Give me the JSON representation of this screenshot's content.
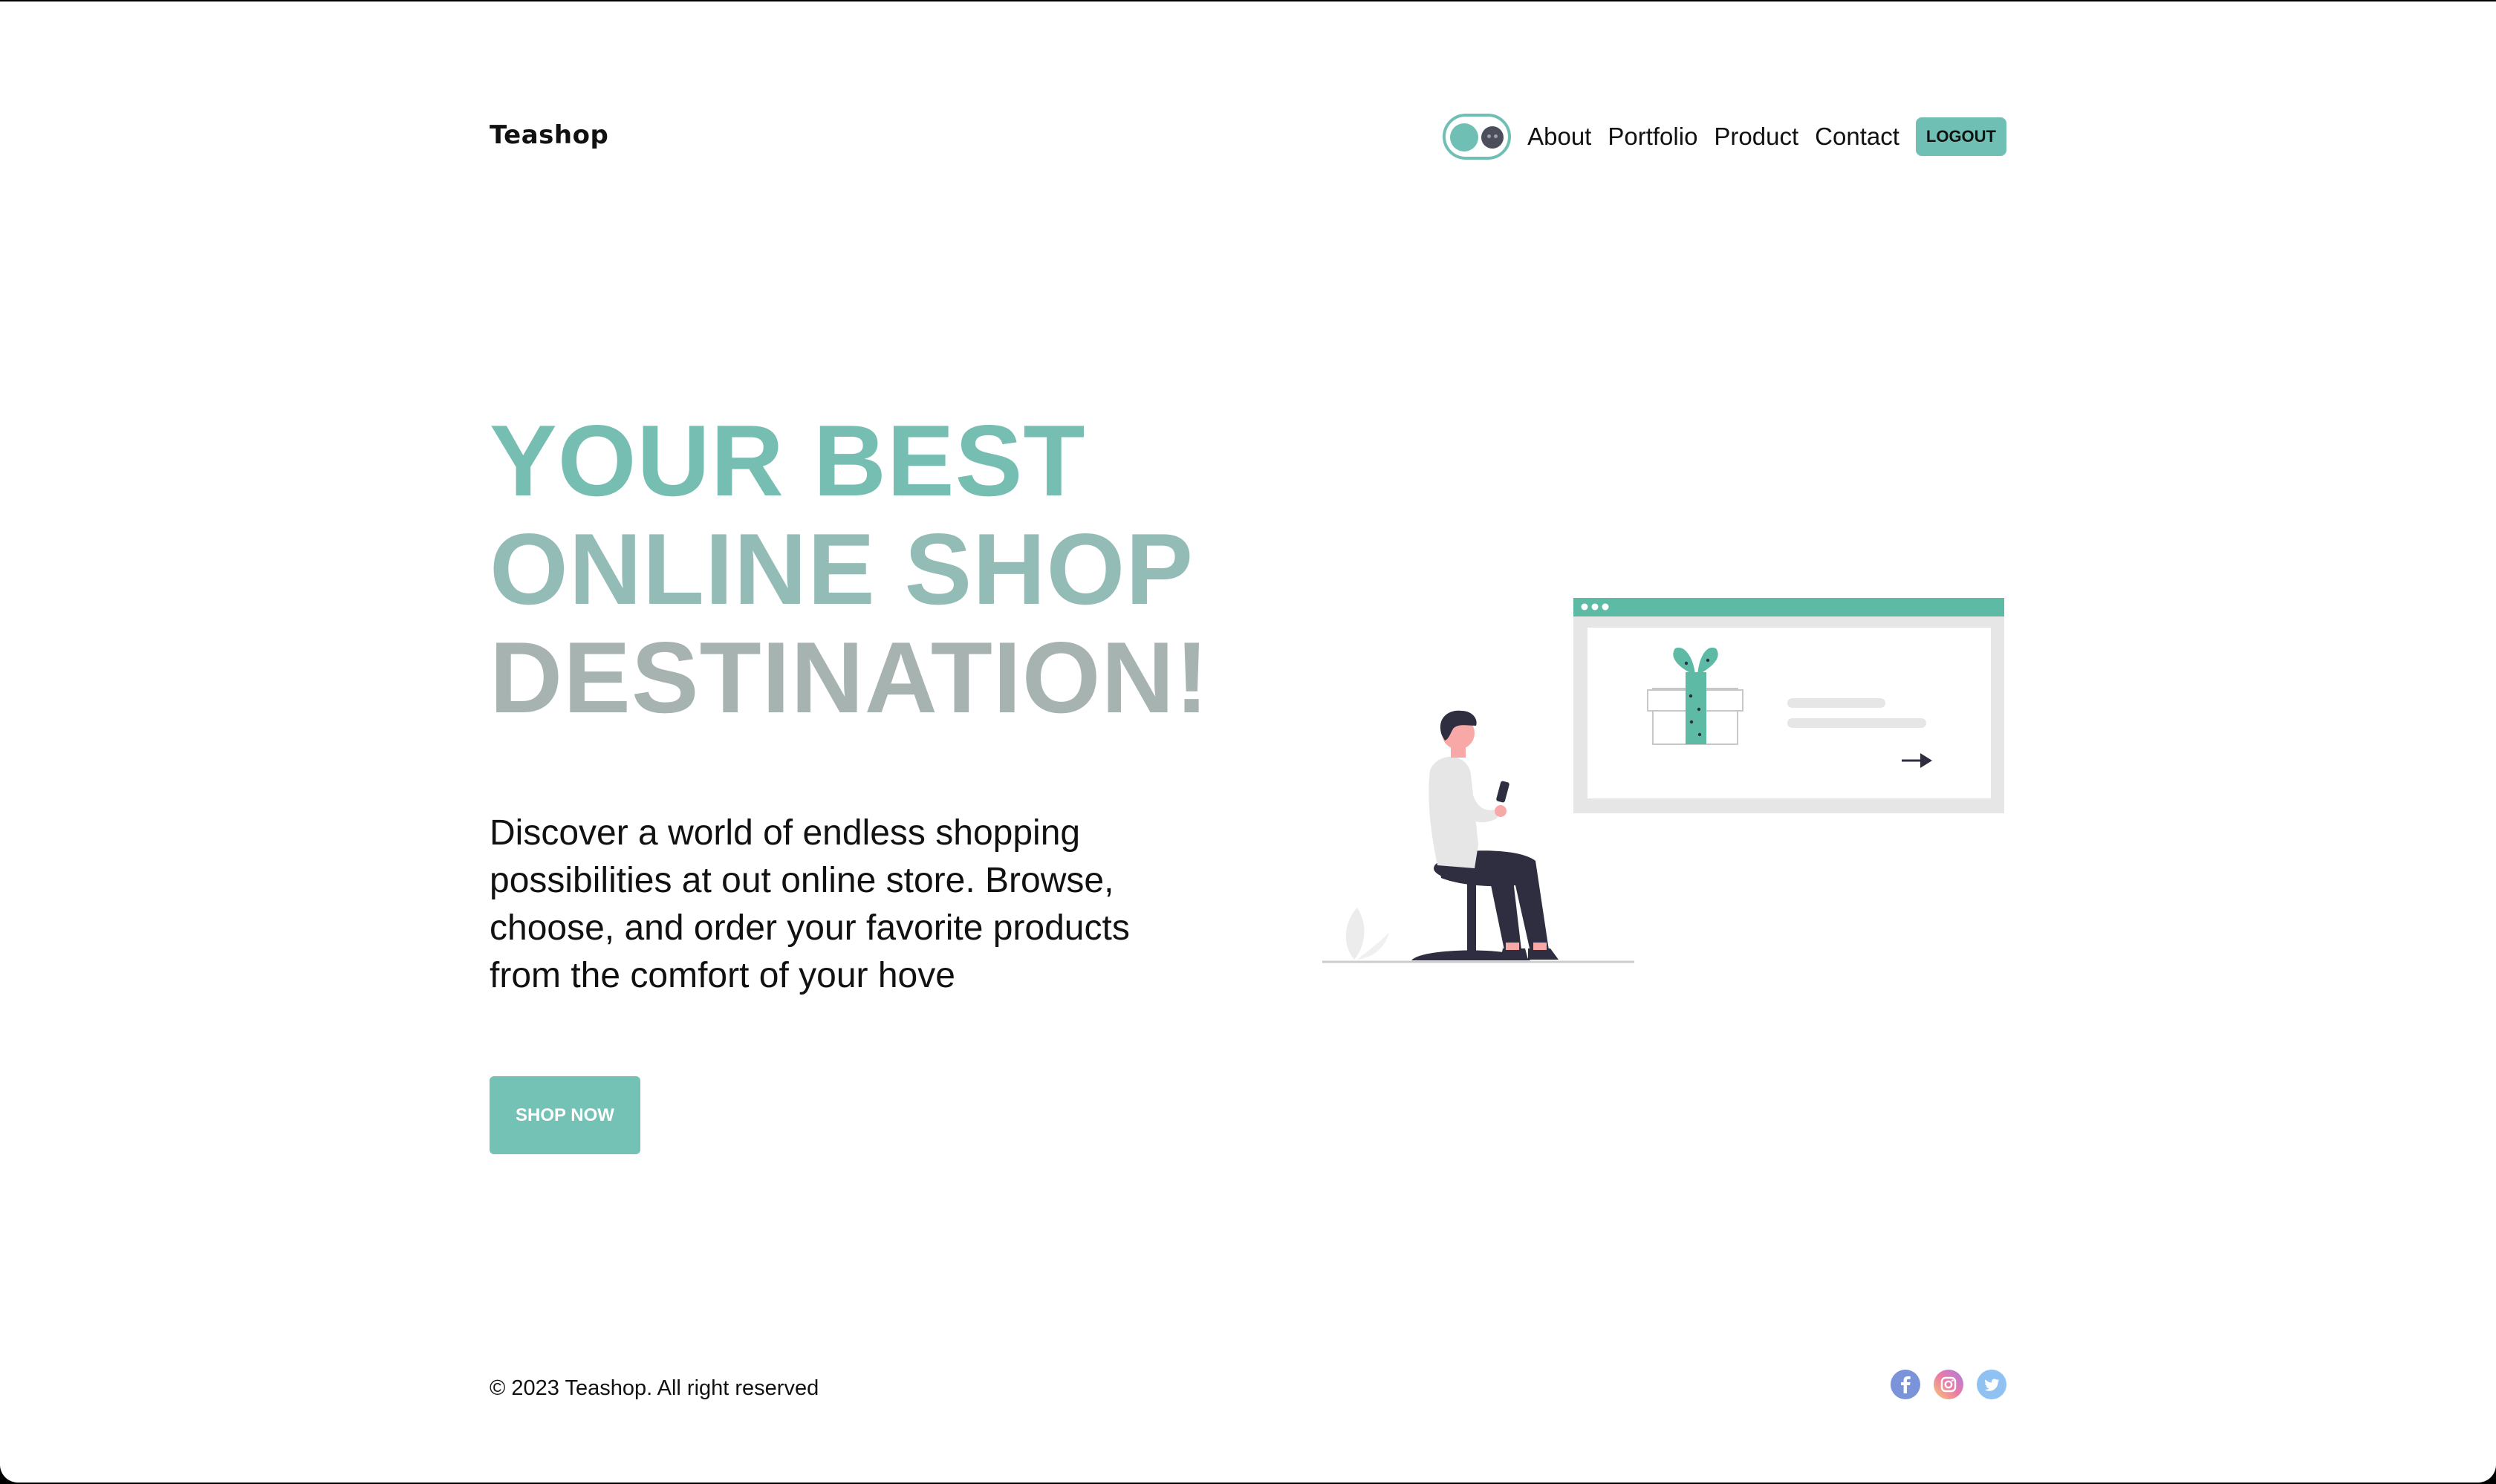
{
  "header": {
    "brand": "Teashop",
    "nav": [
      "About",
      "Portfolio",
      "Product",
      "Contact"
    ],
    "logout_label": "LOGOUT",
    "theme_toggle": "dark-mode-toggle"
  },
  "hero": {
    "title_lines": [
      "YOUR BEST",
      "ONLINE SHOP",
      "DESTINATION!"
    ],
    "description": "Discover a world of endless shopping possibilities at out online store. Browse, choose, and order your favorite products from the comfort of your hove",
    "cta_label": "SHOP NOW"
  },
  "footer": {
    "copyright": "© 2023 Teashop. All right reserved",
    "social_icons": [
      "facebook-icon",
      "instagram-icon",
      "twitter-icon"
    ]
  },
  "colors": {
    "accent": "#74c1b6",
    "title_1": "#76bdb2",
    "title_2": "#94bcb6",
    "title_3": "#a7b3b1"
  }
}
